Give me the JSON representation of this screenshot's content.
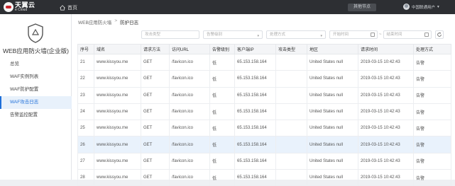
{
  "topbar": {
    "logo_cn": "天翼云",
    "logo_en": "e Cloud",
    "home_label": "首页",
    "node_button": "其他节点",
    "user_name": "中国联通用户"
  },
  "sidebar": {
    "product_title": "WEB应用防火墙(企业版)",
    "items": [
      {
        "label": "总览"
      },
      {
        "label": "WAF实例列表"
      },
      {
        "label": "WAF防护配置"
      },
      {
        "label": "WAF攻击日志"
      },
      {
        "label": "告警监控配置"
      }
    ]
  },
  "breadcrumb": {
    "parent": "WEB应用防火墙",
    "separator": ">",
    "current": "防护日志"
  },
  "filters": {
    "attack_type": "攻击类型",
    "alert_level": "告警级别",
    "action": "处理方式",
    "start_time": "开始时间",
    "range_sep": "~",
    "end_time": "结束时间"
  },
  "table": {
    "headers": [
      "序号",
      "域名",
      "请求方法",
      "访问URL",
      "告警级别",
      "客户端IP",
      "攻击类型",
      "地区",
      "请求时间",
      "处理方式"
    ],
    "rows": [
      {
        "no": "21",
        "domain": "www.kissyou.me",
        "method": "GET",
        "url": "/favicon.ico",
        "level": "低",
        "ip": "65.153.158.164",
        "type": "",
        "region": "United States null",
        "time": "2019-03-15 10:42:43",
        "action": "告警"
      },
      {
        "no": "22",
        "domain": "www.kissyou.me",
        "method": "GET",
        "url": "/favicon.ico",
        "level": "低",
        "ip": "65.153.158.164",
        "type": "",
        "region": "United States null",
        "time": "2019-03-15 10:42:43",
        "action": "告警"
      },
      {
        "no": "23",
        "domain": "www.kissyou.me",
        "method": "GET",
        "url": "/favicon.ico",
        "level": "低",
        "ip": "65.153.158.164",
        "type": "",
        "region": "United States null",
        "time": "2019-03-15 10:42:43",
        "action": "告警"
      },
      {
        "no": "24",
        "domain": "www.kissyou.me",
        "method": "GET",
        "url": "/favicon.ico",
        "level": "低",
        "ip": "65.153.158.164",
        "type": "",
        "region": "United States null",
        "time": "2019-03-15 10:42:43",
        "action": "告警"
      },
      {
        "no": "25",
        "domain": "www.kissyou.me",
        "method": "GET",
        "url": "/favicon.ico",
        "level": "低",
        "ip": "65.153.158.164",
        "type": "",
        "region": "United States null",
        "time": "2019-03-15 10:42:43",
        "action": "告警"
      },
      {
        "no": "26",
        "domain": "www.kissyou.me",
        "method": "GET",
        "url": "/favicon.ico",
        "level": "低",
        "ip": "65.153.158.164",
        "type": "",
        "region": "United States null",
        "time": "2019-03-15 10:42:43",
        "action": "告警"
      },
      {
        "no": "27",
        "domain": "www.kissyou.me",
        "method": "GET",
        "url": "/favicon.ico",
        "level": "低",
        "ip": "65.153.158.164",
        "type": "",
        "region": "United States null",
        "time": "2019-03-15 10:42:43",
        "action": "告警"
      },
      {
        "no": "28",
        "domain": "www.kissyou.me",
        "method": "GET",
        "url": "/favicon.ico",
        "level": "低",
        "ip": "65.153.158.164",
        "type": "",
        "region": "United States null",
        "time": "2019-03-15 10:42:43",
        "action": "告警"
      }
    ]
  },
  "colors": {
    "accent": "#1e6fd9",
    "topbar_bg": "#2d2f33",
    "row_highlight": "#e9f2fc"
  }
}
